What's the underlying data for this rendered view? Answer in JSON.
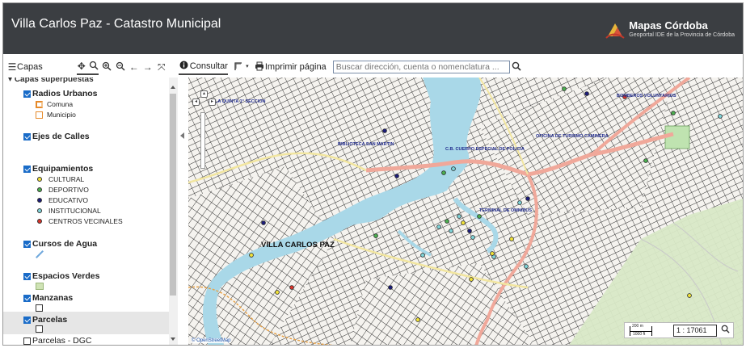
{
  "header": {
    "title": "Villa Carlos Paz - Catastro Municipal",
    "logo_name": "Mapas Córdoba",
    "logo_sub": "Geoportal IDE de la Provincia de Córdoba"
  },
  "toolbar": {
    "layers_label": "Capas",
    "nav_icons": [
      "pan-icon",
      "zoom-in-icon",
      "zoom-box-icon",
      "zoom-out-icon",
      "back-icon",
      "forward-icon",
      "full-extent-icon"
    ],
    "consultar_label": "Consultar",
    "print_label": "Imprimir página",
    "search_placeholder": "Buscar dirección, cuenta o nomenclatura ..."
  },
  "sidebar": {
    "root_label": "Capas superpuestas",
    "layers": [
      {
        "label": "Radios Urbanos",
        "checked": true
      },
      {
        "label": "Ejes de Calles",
        "checked": true
      },
      {
        "label": "Equipamientos",
        "checked": true
      },
      {
        "label": "Cursos de Agua",
        "checked": true
      },
      {
        "label": "Espacios Verdes",
        "checked": true
      },
      {
        "label": "Manzanas",
        "checked": true
      },
      {
        "label": "Parcelas",
        "checked": true
      },
      {
        "label": "Parcelas - DGC",
        "checked": false
      }
    ],
    "radios_legend": [
      "Comuna",
      "Municipio"
    ],
    "equip_legend": [
      {
        "label": "CULTURAL",
        "color": "#f2e33a"
      },
      {
        "label": "DEPORTIVO",
        "color": "#4caf50"
      },
      {
        "label": "EDUCATIVO",
        "color": "#1d1d7a"
      },
      {
        "label": "INSTITUCIONAL",
        "color": "#7fd3d8"
      },
      {
        "label": "CENTROS VECINALES",
        "color": "#d9342b"
      }
    ]
  },
  "map": {
    "city_label": "VILLA CARLOS PAZ",
    "attribution": "© OpenStreetMap",
    "scale_m": "200 m",
    "scale_ft": "1000 ft",
    "scale_value": "1 : 17061",
    "labels": [
      "LA QUINTA 1° SECCION",
      "BIBLIOTECA SAN MARTIN",
      "C.B. CUERPO ESPECIAL DE POLICIA",
      "BOMBEROS VOLUNTARIOS",
      "OFICINA DE TURISMO CAMINERA",
      "TERMINAL DE OMNIBUS"
    ]
  }
}
